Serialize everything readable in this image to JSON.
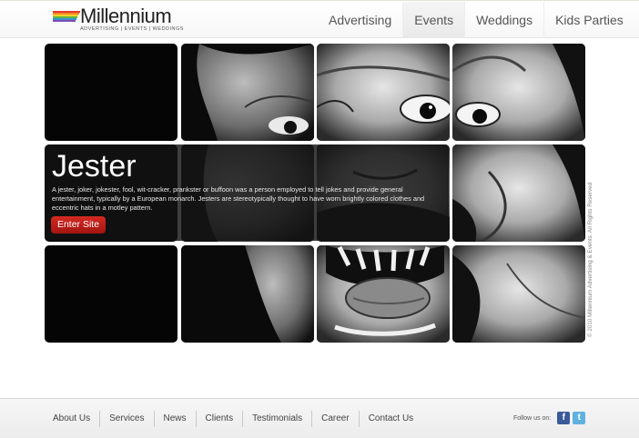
{
  "header": {
    "brand_name": "Millennium",
    "brand_tagline": "ADVERTISING | EVENTS | WEDDINGS",
    "brand_stripe_colors": [
      "#e53b2f",
      "#f08a24",
      "#f4d12a",
      "#5fb745",
      "#3b8fd3",
      "#7c4fb3"
    ],
    "nav": [
      {
        "label": "Advertising",
        "active": false
      },
      {
        "label": "Events",
        "active": true
      },
      {
        "label": "Weddings",
        "active": false
      },
      {
        "label": "Kids Parties",
        "active": false
      }
    ]
  },
  "feature": {
    "title": "Jester",
    "description": "A jester, joker, jokester, fool, wit-cracker, prankster or buffoon was a person employed to tell jokes and provide general entertainment, typically by a European monarch. Jesters are stereotypically thought to have worn brightly colored clothes and eccentric hats in a motley pattern.",
    "cta_label": "Enter Site",
    "cta_color": "#c21d17"
  },
  "copyright": "© 2010 Millennium Advertising & Events. All Rights Reserved",
  "footer": {
    "links": [
      "About Us",
      "Services",
      "News",
      "Clients",
      "Testimonials",
      "Career",
      "Contact Us"
    ],
    "follow_label": "Follow us on:",
    "social": [
      {
        "icon": "facebook-icon",
        "glyph": "f",
        "color": "#3b5a9a"
      },
      {
        "icon": "twitter-icon",
        "glyph": "t",
        "color": "#5fb2e0"
      }
    ]
  }
}
